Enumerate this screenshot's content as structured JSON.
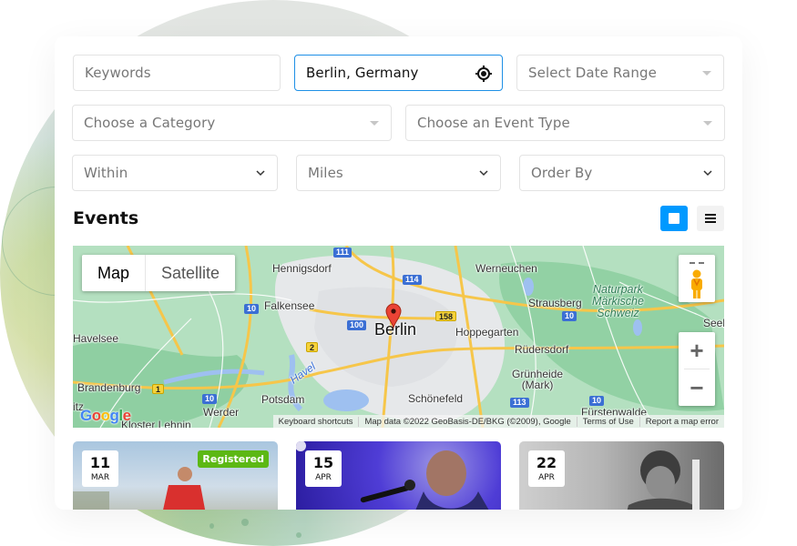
{
  "filters": {
    "keywords": {
      "placeholder": "Keywords",
      "value": ""
    },
    "location": {
      "value": "Berlin, Germany",
      "icon": "locate-target-icon"
    },
    "date_range": {
      "placeholder": "Select Date Range"
    },
    "category": {
      "placeholder": "Choose a Category"
    },
    "event_type": {
      "placeholder": "Choose an Event Type"
    },
    "within": {
      "selected": "Within"
    },
    "units": {
      "selected": "Miles"
    },
    "order_by": {
      "selected": "Order By"
    }
  },
  "events_section": {
    "title": "Events",
    "view_modes": [
      {
        "name": "grid",
        "icon": "grid-view-icon",
        "active": true
      },
      {
        "name": "list",
        "icon": "list-view-icon",
        "active": false
      }
    ]
  },
  "map": {
    "type_buttons": {
      "map": "Map",
      "satellite": "Satellite"
    },
    "active_type": "Map",
    "center_marker": "Berlin",
    "labels": {
      "berlin": "Berlin",
      "hennigsdorf": "Hennigsdorf",
      "werneuchen": "Werneuchen",
      "falkensee": "Falkensee",
      "strausberg": "Strausberg",
      "naturpark": "Naturpark\nMärkische\nSchweiz",
      "havelsee": "Havelsee",
      "hoppegarten": "Hoppegarten",
      "ruedersdorf": "Rüdersdorf",
      "seel": "Seel",
      "brandenburg": "Brandenburg",
      "potsdam": "Potsdam",
      "schoenefeld": "Schönefeld",
      "gruenheide": "Grünheide\n(Mark)",
      "werder": "Werder",
      "kloster": "Kloster Lehnin",
      "fuerstenwalde": "Fürstenwalde",
      "havel": "Havel",
      "itz": "itz"
    },
    "road_shields": [
      "111",
      "114",
      "10",
      "100",
      "158",
      "2",
      "1",
      "10",
      "10",
      "10",
      "113"
    ],
    "zoom_in": "+",
    "zoom_out": "−",
    "google_logo": "Google",
    "attribution": {
      "shortcuts": "Keyboard shortcuts",
      "data": "Map data ©2022 GeoBasis-DE/BKG (©2009), Google",
      "terms": "Terms of Use",
      "report": "Report a map error"
    }
  },
  "events": [
    {
      "day": "11",
      "month": "MAR",
      "badge": "Registered",
      "theme": "runner"
    },
    {
      "day": "15",
      "month": "APR",
      "badge": null,
      "theme": "concert"
    },
    {
      "day": "22",
      "month": "APR",
      "badge": null,
      "theme": "portrait"
    }
  ],
  "colors": {
    "accent": "#0099ff",
    "active_border": "#1e90e6",
    "registered_badge": "#5cb814",
    "map_green": "#aedcb6"
  }
}
